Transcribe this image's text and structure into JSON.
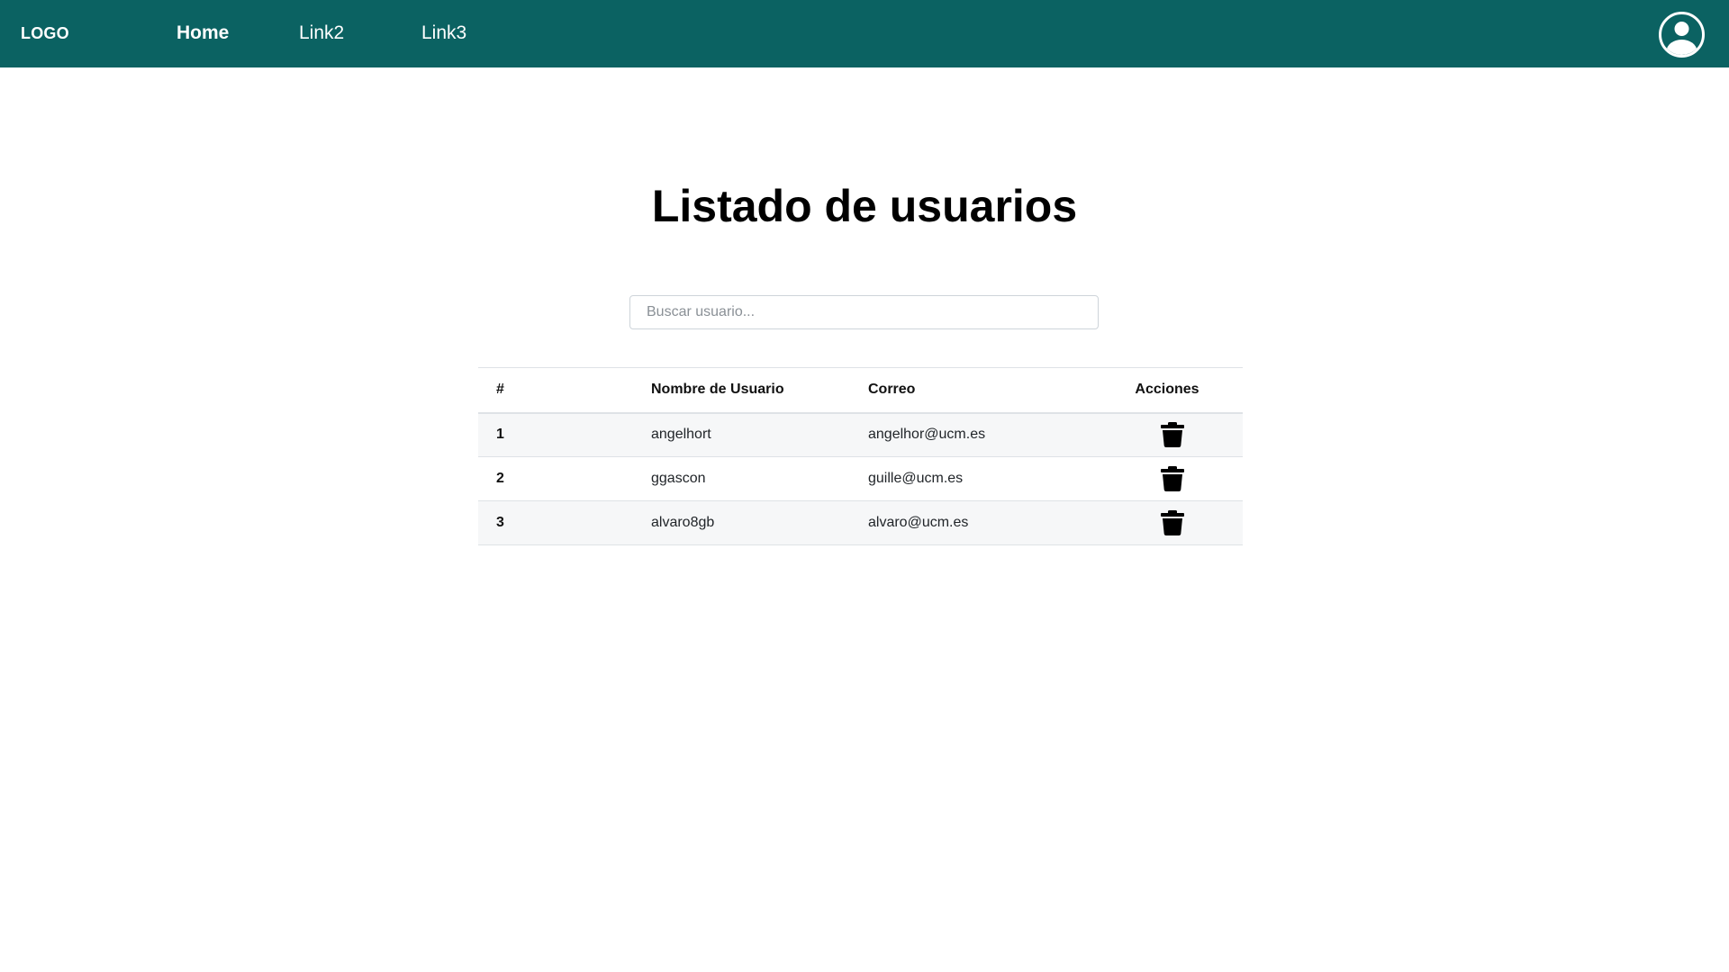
{
  "navbar": {
    "logo": "LOGO",
    "links": [
      {
        "label": "Home",
        "active": true
      },
      {
        "label": "Link2",
        "active": false
      },
      {
        "label": "Link3",
        "active": false
      }
    ],
    "user_icon": "user-circle-icon",
    "background_color": "#0b6262"
  },
  "main": {
    "title": "Listado de usuarios",
    "search": {
      "placeholder": "Buscar usuario...",
      "value": ""
    },
    "table": {
      "headers": [
        "#",
        "Nombre de Usuario",
        "Correo",
        "Acciones"
      ],
      "rows": [
        {
          "num": "1",
          "username": "angelhort",
          "email": "angelhor@ucm.es",
          "action_icon": "trash-icon"
        },
        {
          "num": "2",
          "username": "ggascon",
          "email": "guille@ucm.es",
          "action_icon": "trash-icon"
        },
        {
          "num": "3",
          "username": "alvaro8gb",
          "email": "alvaro@ucm.es",
          "action_icon": "trash-icon"
        }
      ]
    }
  }
}
